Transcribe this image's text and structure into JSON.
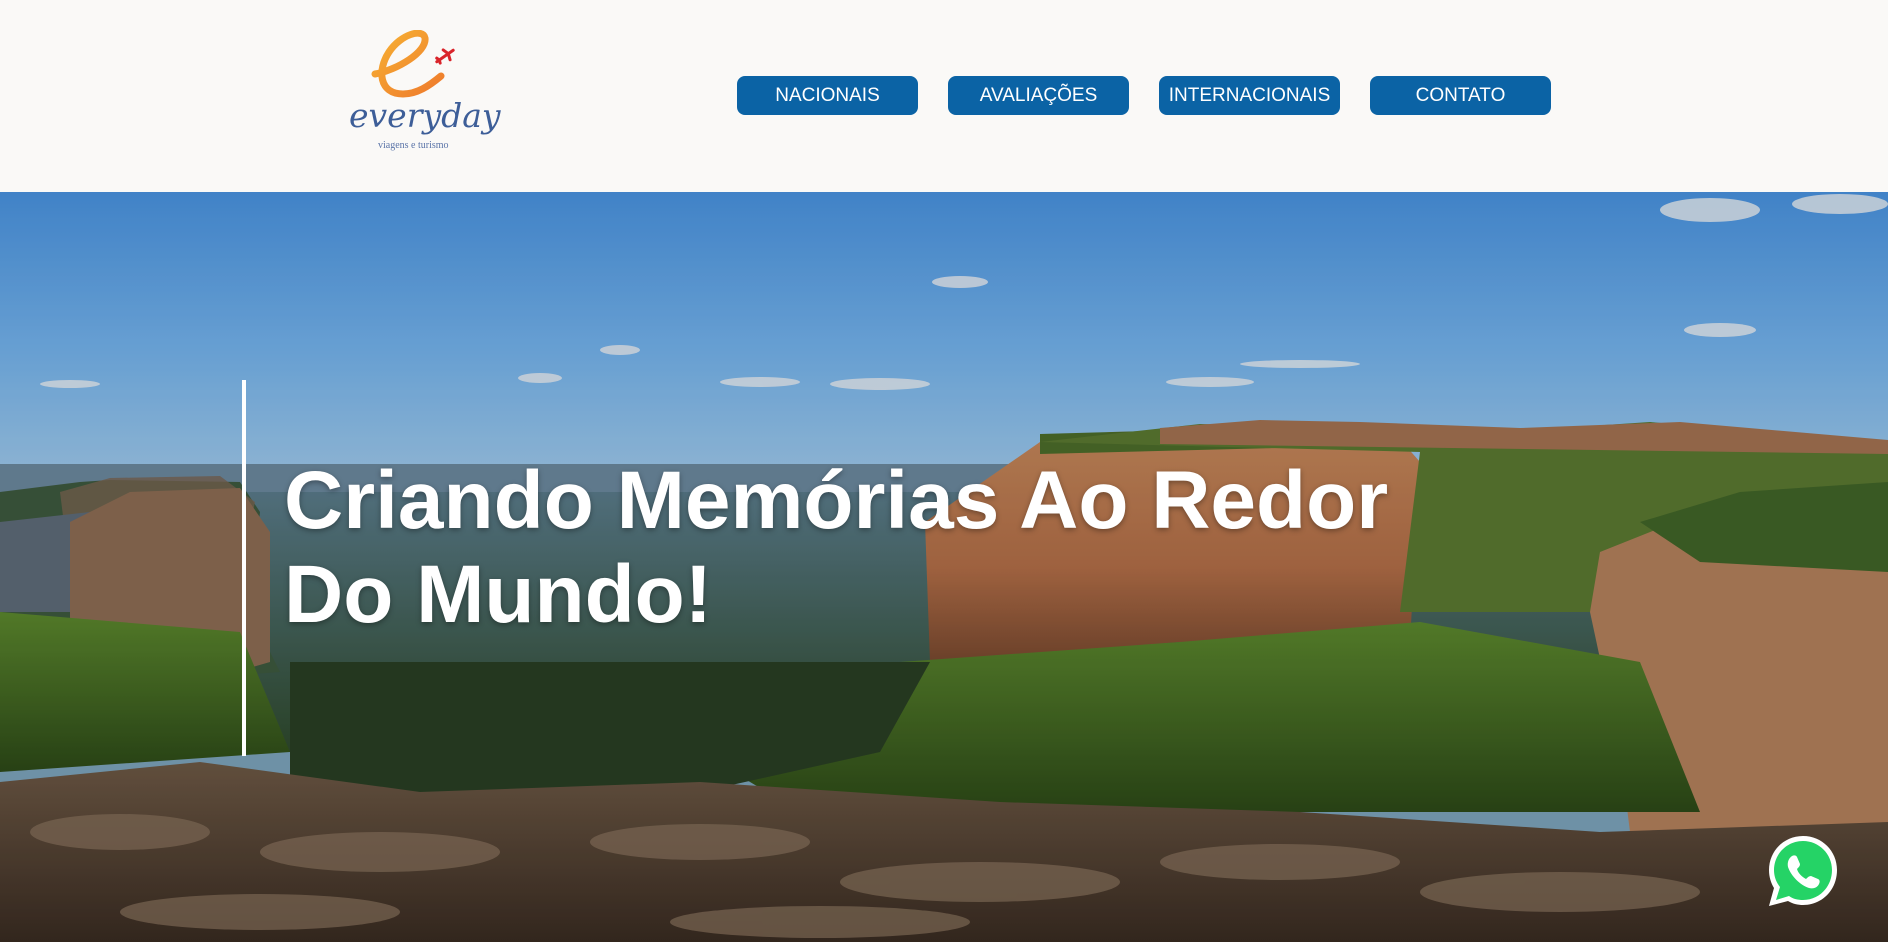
{
  "header": {
    "logo": {
      "brand": "everyday",
      "tagline": "viagens e turismo",
      "colors": {
        "accent": "#f2922f",
        "plane": "#d9242a",
        "text": "#3d5e98"
      }
    },
    "nav": [
      {
        "label": "NACIONAIS"
      },
      {
        "label": "AVALIAÇÕES"
      },
      {
        "label": "INTERNACIONAIS"
      },
      {
        "label": "CONTATO"
      }
    ],
    "nav_color": "#0b63a5"
  },
  "hero": {
    "title": "Criando Memórias Ao Redor Do Mundo!"
  },
  "floating": {
    "icon": "whatsapp-icon",
    "color": "#25d366"
  }
}
